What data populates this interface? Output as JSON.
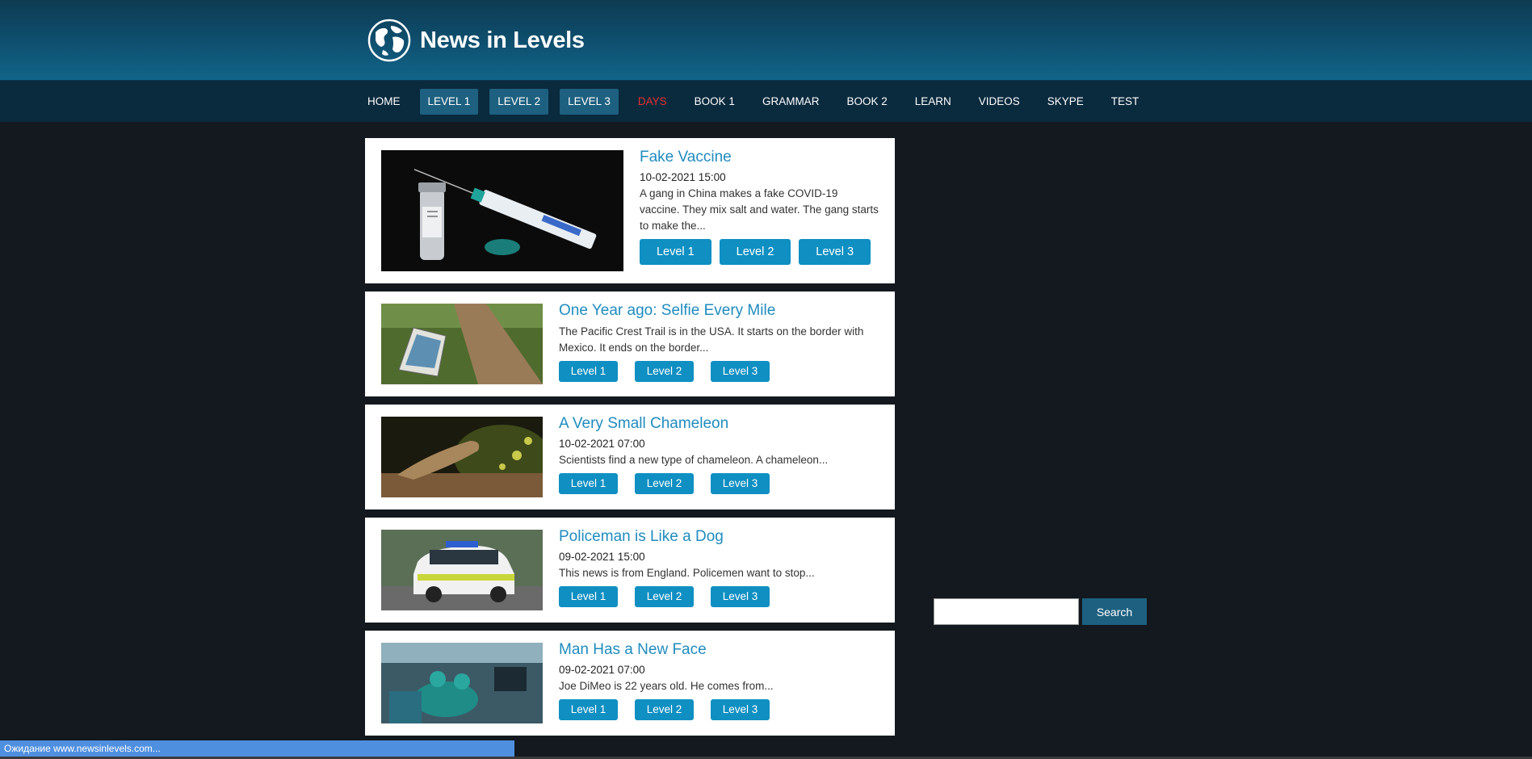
{
  "site": {
    "title": "News in Levels"
  },
  "nav": [
    {
      "label": "HOME",
      "style": ""
    },
    {
      "label": "LEVEL 1",
      "style": "hl"
    },
    {
      "label": "LEVEL 2",
      "style": "hl"
    },
    {
      "label": "LEVEL 3",
      "style": "hl"
    },
    {
      "label": "DAYS",
      "style": "red"
    },
    {
      "label": "BOOK 1",
      "style": ""
    },
    {
      "label": "GRAMMAR",
      "style": ""
    },
    {
      "label": "BOOK 2",
      "style": ""
    },
    {
      "label": "LEARN",
      "style": ""
    },
    {
      "label": "VIDEOS",
      "style": ""
    },
    {
      "label": "SKYPE",
      "style": ""
    },
    {
      "label": "TEST",
      "style": ""
    }
  ],
  "articles": [
    {
      "title": "Fake Vaccine",
      "date": "10-02-2021 15:00",
      "excerpt": "A gang in China makes a fake COVID-19 vaccine. They mix salt and water. The gang starts to make the...",
      "image": "vaccine-photo",
      "size": "big"
    },
    {
      "title": "One Year ago: Selfie Every Mile",
      "date": "",
      "excerpt": "The Pacific Crest Trail is in the USA. It starts on the border with Mexico. It ends on the border...",
      "image": "trail-photo",
      "size": "small"
    },
    {
      "title": "A Very Small Chameleon",
      "date": "10-02-2021 07:00",
      "excerpt": "Scientists find a new type of chameleon. A chameleon...",
      "image": "chameleon-photo",
      "size": "small"
    },
    {
      "title": "Policeman is Like a Dog",
      "date": "09-02-2021 15:00",
      "excerpt": "This news is from England. Policemen want to stop...",
      "image": "police-car-photo",
      "size": "small"
    },
    {
      "title": "Man Has a New Face",
      "date": "09-02-2021 07:00",
      "excerpt": "Joe DiMeo is 22 years old. He comes from...",
      "image": "surgery-photo",
      "size": "small"
    }
  ],
  "levels": [
    "Level 1",
    "Level 2",
    "Level 3"
  ],
  "search": {
    "button_label": "Search",
    "placeholder": ""
  },
  "status": {
    "text": "Ожидание www.newsinlevels.com..."
  },
  "colors": {
    "accent": "#0f8fc2",
    "title": "#1f8cbf",
    "nav_bg": "#0a2a3e",
    "days": "#e83030"
  }
}
